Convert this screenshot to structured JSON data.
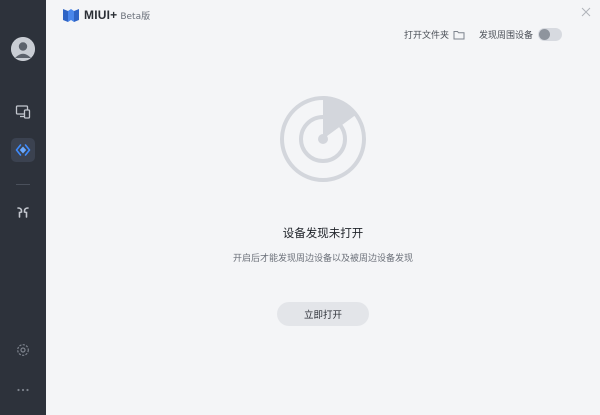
{
  "app": {
    "name": "MIUI+",
    "badge": "Beta版"
  },
  "toolbar": {
    "open_folder_label": "打开文件夹",
    "discover_label": "发现周围设备",
    "discover_enabled": false
  },
  "empty_state": {
    "title": "设备发现未打开",
    "description": "开启后才能发现周边设备以及被周边设备发现",
    "button_label": "立即打开"
  },
  "sidebar": {
    "items": [
      {
        "icon": "user-avatar-icon",
        "active": false
      },
      {
        "icon": "screen-cast-icon",
        "active": false
      },
      {
        "icon": "device-discover-icon",
        "active": true
      },
      {
        "icon": "earbuds-icon",
        "active": false
      },
      {
        "icon": "settings-gear-icon",
        "active": false
      },
      {
        "icon": "more-dots-icon",
        "active": false
      }
    ]
  },
  "colors": {
    "sidebar_bg": "#2d323b",
    "main_bg": "#f4f5f7",
    "accent_blue": "#3d8bfd",
    "illustration_gray": "#d3d6dc"
  }
}
